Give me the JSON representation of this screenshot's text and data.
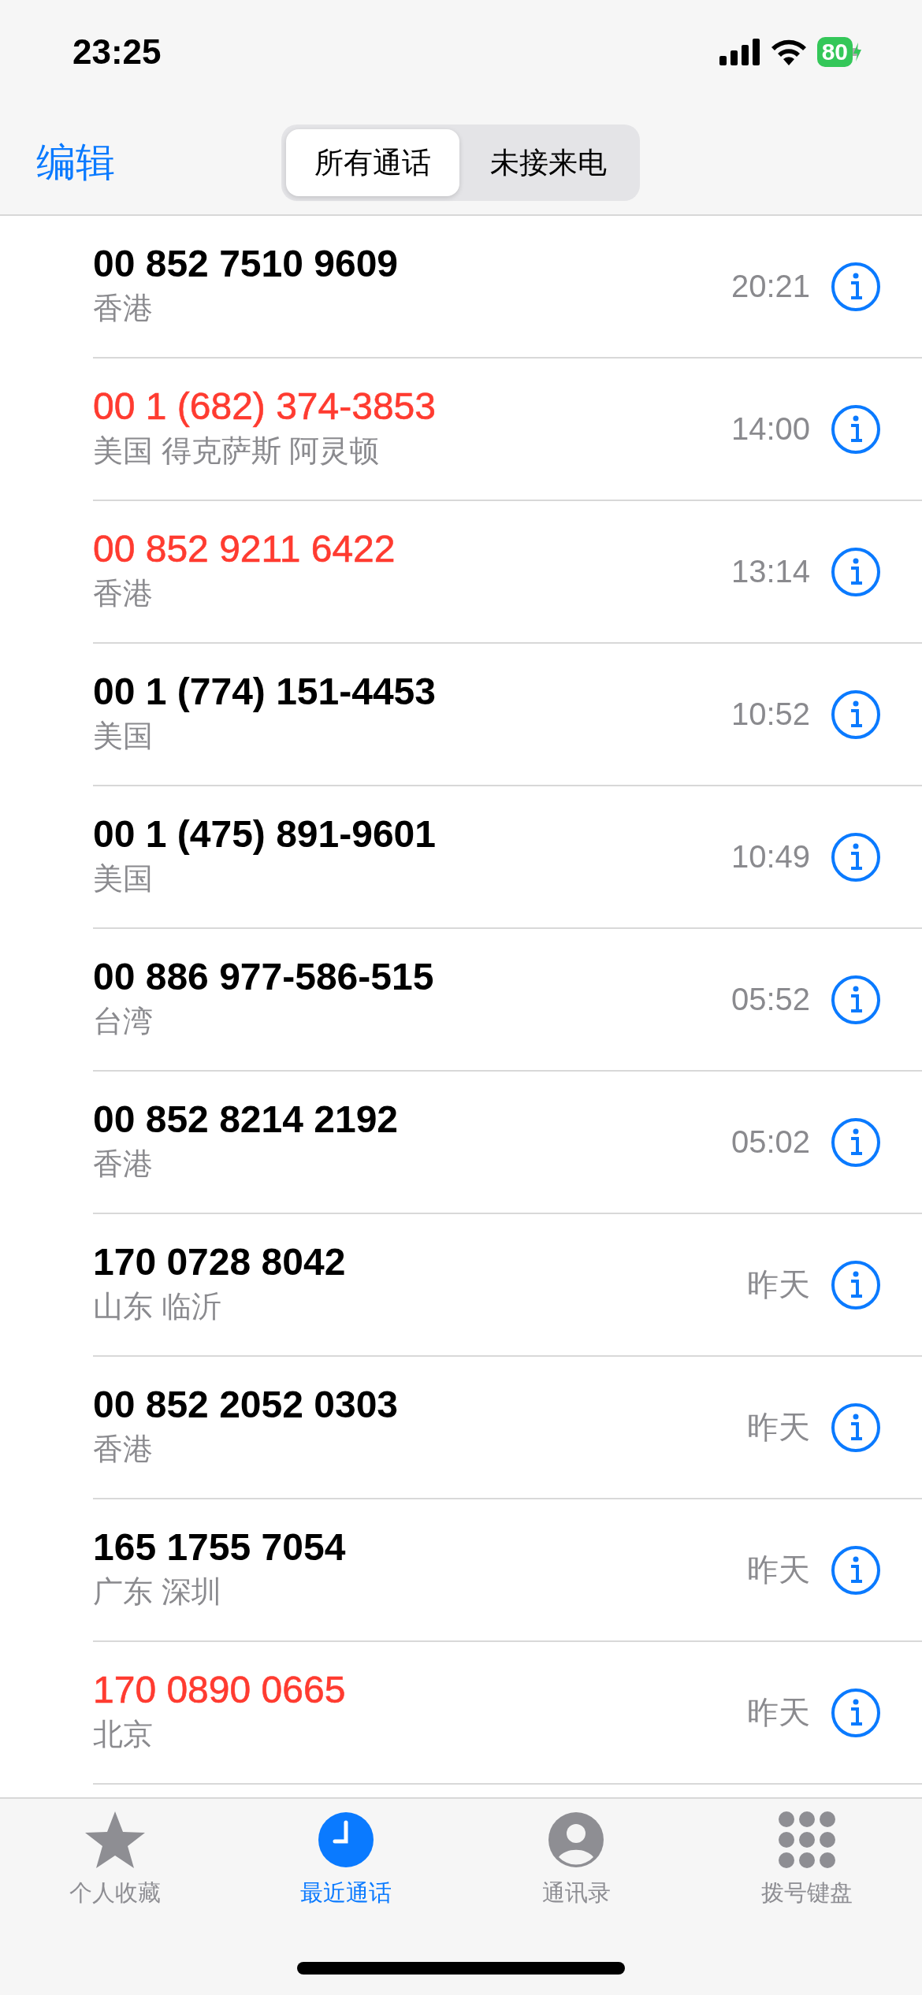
{
  "status_bar": {
    "time": "23:25",
    "battery": "80"
  },
  "nav": {
    "edit": "编辑",
    "segments": [
      {
        "label": "所有通话",
        "selected": true
      },
      {
        "label": "未接来电",
        "selected": false
      }
    ]
  },
  "calls": [
    {
      "number": "00 852 7510 9609",
      "location": "香港",
      "time": "20:21",
      "missed": false
    },
    {
      "number": "00 1 (682) 374-3853",
      "location": "美国 得克萨斯 阿灵顿",
      "time": "14:00",
      "missed": true
    },
    {
      "number": "00 852 9211 6422",
      "location": "香港",
      "time": "13:14",
      "missed": true
    },
    {
      "number": "00 1 (774) 151-4453",
      "location": "美国",
      "time": "10:52",
      "missed": false
    },
    {
      "number": "00 1 (475) 891-9601",
      "location": "美国",
      "time": "10:49",
      "missed": false
    },
    {
      "number": "00 886 977-586-515",
      "location": "台湾",
      "time": "05:52",
      "missed": false
    },
    {
      "number": "00 852 8214 2192",
      "location": "香港",
      "time": "05:02",
      "missed": false
    },
    {
      "number": "170 0728 8042",
      "location": "山东 临沂",
      "time": "昨天",
      "missed": false
    },
    {
      "number": "00 852 2052 0303",
      "location": "香港",
      "time": "昨天",
      "missed": false
    },
    {
      "number": "165 1755 7054",
      "location": "广东 深圳",
      "time": "昨天",
      "missed": false
    },
    {
      "number": "170 0890 0665",
      "location": "北京",
      "time": "昨天",
      "missed": true
    }
  ],
  "tab_bar": [
    {
      "kind": "favorites",
      "label": "个人收藏",
      "selected": false
    },
    {
      "kind": "recents",
      "label": "最近通话",
      "selected": true
    },
    {
      "kind": "contacts",
      "label": "通讯录",
      "selected": false
    },
    {
      "kind": "keypad",
      "label": "拨号键盘",
      "selected": false
    }
  ]
}
